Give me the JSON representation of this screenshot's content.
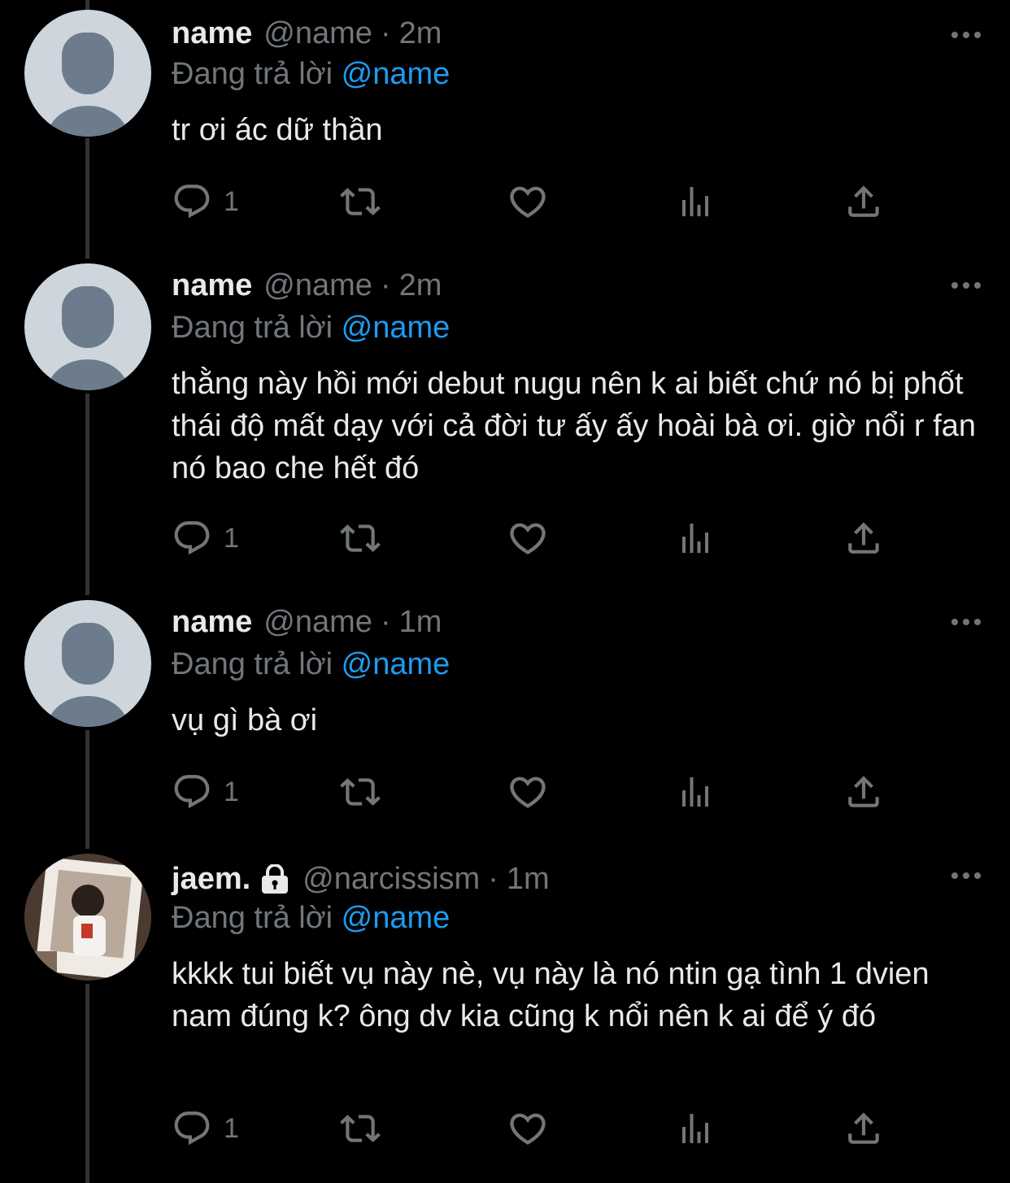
{
  "colors": {
    "background": "#000000",
    "text": "#e7e9ea",
    "secondary": "#71767b",
    "mention": "#1d9bf0",
    "avatar_bg": "#ced5dc",
    "avatar_fg": "#6c7c8c"
  },
  "icons": {
    "reply": "reply-icon",
    "retweet": "retweet-icon",
    "like": "heart-icon",
    "views": "views-icon",
    "share": "share-icon",
    "more": "more-icon",
    "lock": "lock-icon"
  },
  "tweets": [
    {
      "display_name": "name",
      "handle": "@name",
      "separator": "·",
      "time": "2m",
      "reply_prefix": "Đang trả lời",
      "reply_mention": "@name",
      "text": "tr ơi ác dữ thần",
      "reply_count": "1",
      "avatar": "default-avatar"
    },
    {
      "display_name": "name",
      "handle": "@name",
      "separator": "·",
      "time": "2m",
      "reply_prefix": "Đang trả lời",
      "reply_mention": "@name",
      "text": "thằng này hồi mới debut nugu nên k ai biết chứ nó bị phốt thái độ mất dạy với cả đời tư ấy ấy hoài bà ơi. giờ nổi r fan nó bao che hết đó",
      "reply_count": "1",
      "avatar": "default-avatar"
    },
    {
      "display_name": "name",
      "handle": "@name",
      "separator": "·",
      "time": "1m",
      "reply_prefix": "Đang trả lời",
      "reply_mention": "@name",
      "text": "vụ gì bà ơi",
      "reply_count": "1",
      "avatar": "default-avatar"
    },
    {
      "display_name": "jaem.",
      "handle": "@narcissism",
      "separator": "·",
      "time": "1m",
      "reply_prefix": "Đang trả lời",
      "reply_mention": "@name",
      "text": "kkkk tui biết vụ này nè, vụ này là nó ntin gạ tình 1 dvien nam đúng k? ông dv kia cũng k nổi nên k ai để ý đó",
      "reply_count": "1",
      "avatar": "photo-avatar",
      "protected": true
    }
  ]
}
